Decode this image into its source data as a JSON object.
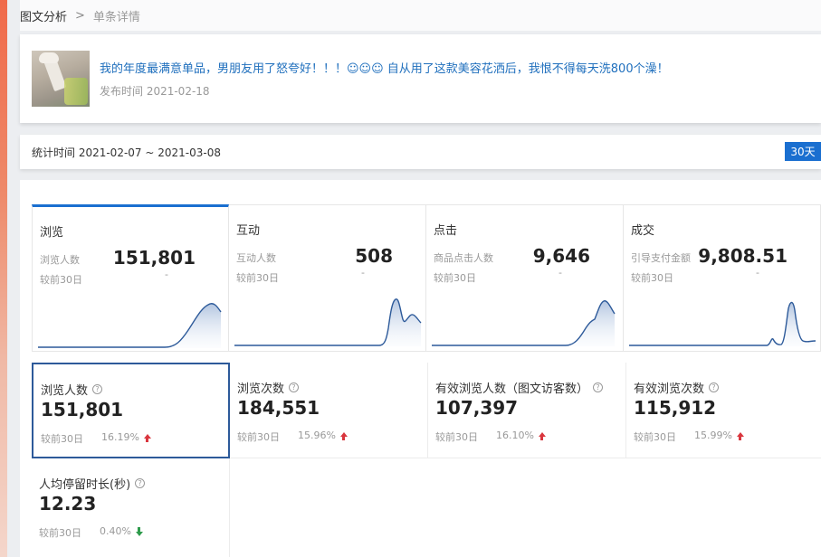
{
  "breadcrumb": {
    "parent": "图文分析",
    "separator": ">",
    "current": "单条详情"
  },
  "post": {
    "title": "我的年度最满意单品，男朋友用了怒夸好！！！☺☺☺ 自从用了这款美容花洒后，我恨不得每天洗800个澡！",
    "date_text": "发布时间 2021-02-18"
  },
  "stats": {
    "range_text": "统计时间 2021-02-07 ~ 2021-03-08",
    "period_button": "30天"
  },
  "overview": [
    {
      "title": "浏览",
      "metric_label": "浏览人数",
      "value": "151,801",
      "compare_label": "较前30日",
      "compare_value": "-"
    },
    {
      "title": "互动",
      "metric_label": "互动人数",
      "value": "508",
      "compare_label": "较前30日",
      "compare_value": "-"
    },
    {
      "title": "点击",
      "metric_label": "商品点击人数",
      "value": "9,646",
      "compare_label": "较前30日",
      "compare_value": "-"
    },
    {
      "title": "成交",
      "metric_label": "引导支付金额",
      "value": "9,808.51",
      "compare_label": "较前30日",
      "compare_value": "-"
    }
  ],
  "metrics": [
    {
      "title": "浏览人数",
      "value": "151,801",
      "compare_label": "较前30日",
      "pct": "16.19%",
      "trend": "up"
    },
    {
      "title": "浏览次数",
      "value": "184,551",
      "compare_label": "较前30日",
      "pct": "15.96%",
      "trend": "up"
    },
    {
      "title": "有效浏览人数（图文访客数）",
      "value": "107,397",
      "compare_label": "较前30日",
      "pct": "16.10%",
      "trend": "up"
    },
    {
      "title": "有效浏览次数",
      "value": "115,912",
      "compare_label": "较前30日",
      "pct": "15.99%",
      "trend": "up"
    },
    {
      "title": "人均停留时长(秒)",
      "value": "12.23",
      "compare_label": "较前30日",
      "pct": "0.40%",
      "trend": "down"
    }
  ],
  "colors": {
    "accent": "#1a6fd0",
    "link": "#1f6fbd",
    "up": "#d9363e",
    "down": "#2e9b4c",
    "sparkline": "#2d5a9a"
  },
  "icons": {
    "help": "question-circle-icon",
    "trend_up": "arrow-up-icon",
    "trend_down": "arrow-down-icon"
  }
}
